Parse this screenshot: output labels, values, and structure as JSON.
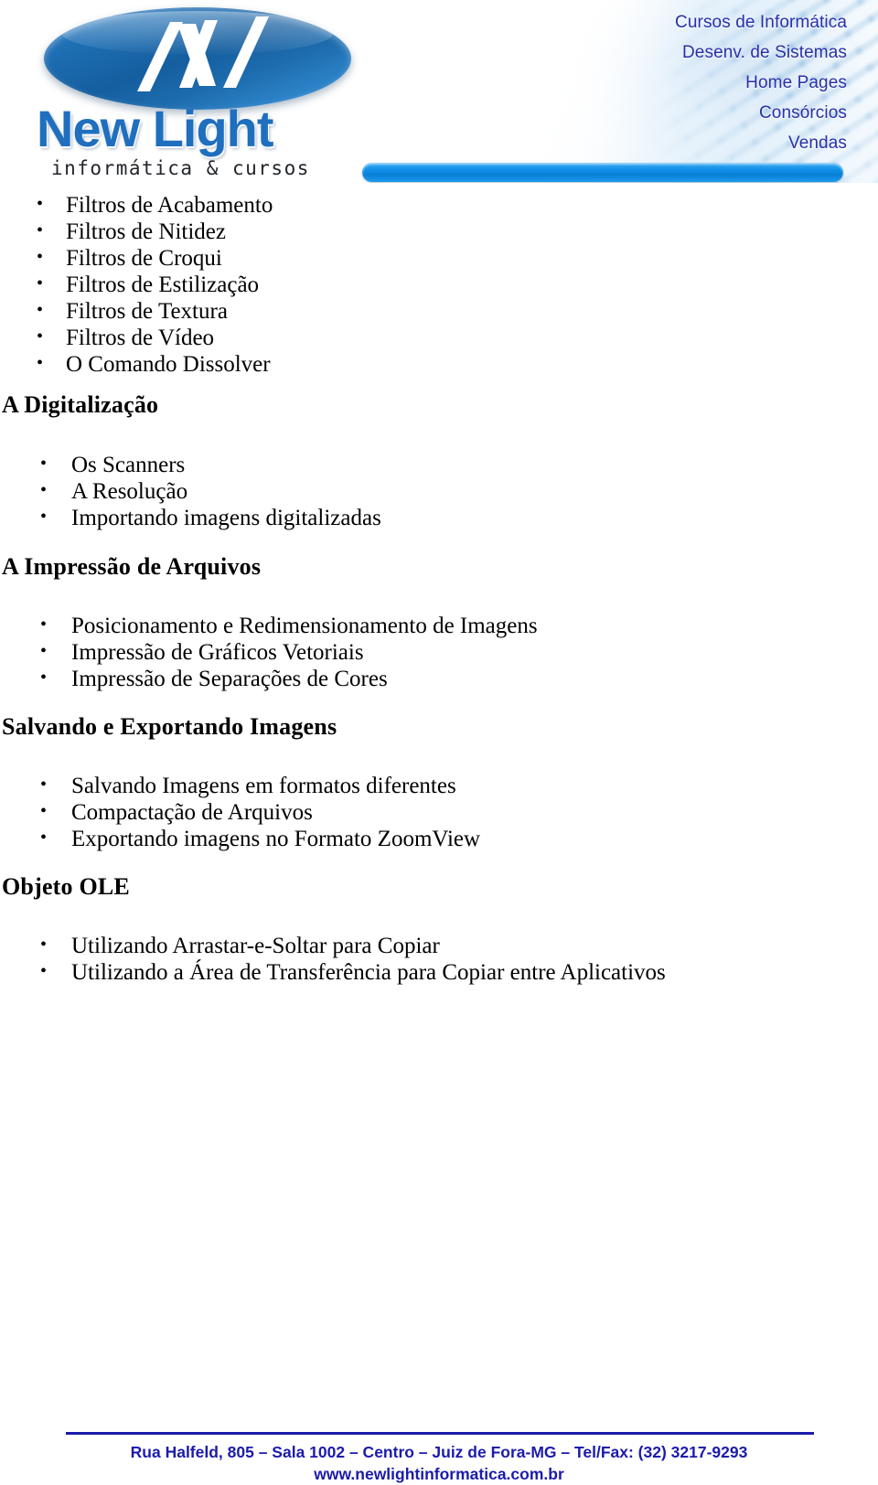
{
  "header": {
    "logo": {
      "brand": "New Light",
      "tagline": "informática & cursos",
      "mark": "stylized-n-ellipse"
    },
    "menu": [
      "Cursos de Informática",
      "Desenv. de Sistemas",
      "Home Pages",
      "Consórcios",
      "Vendas"
    ],
    "accent_color": "#0f8fe8",
    "menu_color": "#2a2fa8"
  },
  "content": {
    "list1": [
      "Filtros de Acabamento",
      "Filtros de Nitidez",
      "Filtros de Croqui",
      "Filtros de Estilização",
      "Filtros de Textura",
      "Filtros de Vídeo",
      "O Comando Dissolver"
    ],
    "heading1": "A Digitalização",
    "list2": [
      "Os Scanners",
      "A Resolução",
      "Importando imagens digitalizadas"
    ],
    "heading2": "A Impressão de Arquivos",
    "list3": [
      "Posicionamento e Redimensionamento de Imagens",
      "Impressão de Gráficos Vetoriais",
      "Impressão de Separações de Cores"
    ],
    "heading3": "Salvando e Exportando Imagens",
    "list4": [
      "Salvando Imagens em formatos diferentes",
      "Compactação de Arquivos",
      "Exportando imagens no Formato ZoomView"
    ],
    "heading4": "Objeto OLE",
    "list5": [
      "Utilizando Arrastar-e-Soltar para Copiar",
      "Utilizando a Área de Transferência para Copiar entre Aplicativos"
    ]
  },
  "footer": {
    "address": "Rua Halfeld, 805 – Sala 1002 – Centro – Juiz de Fora-MG – Tel/Fax: (32) 3217-9293",
    "website": "www.newlightinformatica.com.br",
    "color": "#1b1bab"
  }
}
